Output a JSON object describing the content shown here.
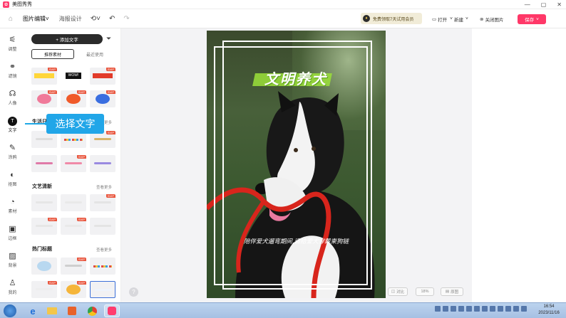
{
  "window": {
    "app_title": "美图秀秀",
    "minimize": "—",
    "maximize": "▢",
    "close": "✕"
  },
  "toolbar": {
    "home_icon": "home-icon",
    "tab_picture_edit": "图片编辑",
    "tab_poster": "海报设计",
    "history_icon": "history-icon",
    "undo_icon": "undo-icon",
    "promo_text": "免费领取7天试用会员",
    "open_label": "打开",
    "new_label": "新建",
    "close_image_label": "关闭图片",
    "save_label": "保存"
  },
  "rail": {
    "items": [
      {
        "label": "调整",
        "icon": "adjust-icon"
      },
      {
        "label": "滤镜",
        "icon": "filter-icon"
      },
      {
        "label": "人像",
        "icon": "portrait-icon"
      },
      {
        "label": "文字",
        "icon": "text-icon",
        "active": true
      },
      {
        "label": "涂鸦",
        "icon": "brush-icon"
      },
      {
        "label": "抠图",
        "icon": "cutout-icon"
      },
      {
        "label": "素材",
        "icon": "sticker-icon"
      },
      {
        "label": "边框",
        "icon": "frame-icon"
      },
      {
        "label": "背景",
        "icon": "background-icon"
      },
      {
        "label": "我的",
        "icon": "user-icon"
      }
    ]
  },
  "panel": {
    "add_text_label": "+ 添加文字",
    "tab_recommended": "推荐素材",
    "tab_recent": "最近使用",
    "sec_life": "生活日",
    "sec_literary": "文艺清新",
    "sec_hot": "热门标题",
    "more_label": "查看更多",
    "svip_label": "SVIP",
    "thumb_wow": "WOW!"
  },
  "tooltip": {
    "text": "选择文字"
  },
  "canvas": {
    "headline": "文明养犬",
    "subline": "陪伴爱犬遛弯期间,请给爱犬穿戴束狗链",
    "compare_label": "对比",
    "zoom_label": "18%",
    "view_label": "原图"
  },
  "taskbar": {
    "time": "16:54",
    "date": "2023/11/16"
  },
  "colors": {
    "accent": "#ff3868",
    "tooltip": "#21a6e8",
    "headline_highlight": "#9be03a"
  }
}
